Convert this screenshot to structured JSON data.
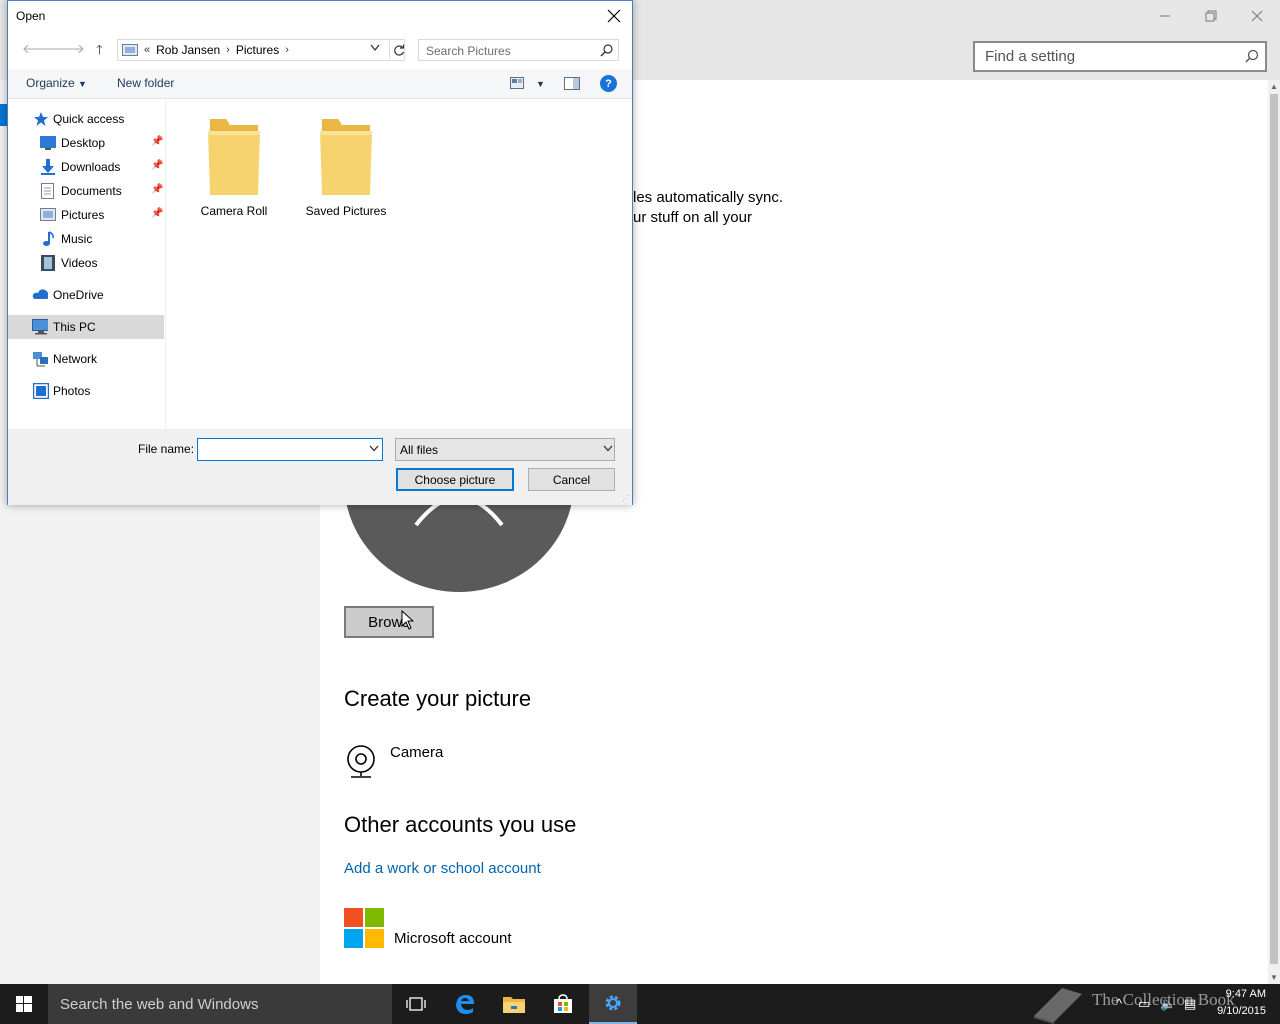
{
  "settings": {
    "search_placeholder": "Find a setting",
    "sync_line1": "les automatically sync.",
    "sync_line2": "ur stuff on all your",
    "browse_label": "Brows",
    "create_heading": "Create your picture",
    "camera_label": "Camera",
    "other_heading": "Other accounts you use",
    "add_work_link": "Add a work or school account",
    "ms_account_label": "Microsoft account",
    "colors": {
      "link": "#0063b1",
      "accent": "#0078d7"
    }
  },
  "dialog": {
    "title": "Open",
    "address": {
      "overflow": "«",
      "crumbs": [
        "Rob Jansen",
        "Pictures"
      ]
    },
    "search_placeholder": "Search Pictures",
    "organize_label": "Organize",
    "new_folder_label": "New folder",
    "help_label": "?",
    "nav": [
      {
        "label": "Quick access",
        "icon": "star-icon"
      },
      {
        "label": "Desktop",
        "icon": "desktop-icon",
        "pinned": true
      },
      {
        "label": "Downloads",
        "icon": "download-icon",
        "pinned": true
      },
      {
        "label": "Documents",
        "icon": "documents-icon",
        "pinned": true
      },
      {
        "label": "Pictures",
        "icon": "pictures-icon",
        "pinned": true
      },
      {
        "label": "Music",
        "icon": "music-icon"
      },
      {
        "label": "Videos",
        "icon": "videos-icon"
      },
      {
        "label": "OneDrive",
        "icon": "onedrive-icon"
      },
      {
        "label": "This PC",
        "icon": "computer-icon",
        "selected": true
      },
      {
        "label": "Network",
        "icon": "network-icon"
      },
      {
        "label": "Photos",
        "icon": "photos-icon"
      }
    ],
    "folders": [
      "Camera Roll",
      "Saved Pictures"
    ],
    "file_name_label": "File name:",
    "file_name_value": "",
    "filter_value": "All files",
    "choose_label": "Choose picture",
    "cancel_label": "Cancel"
  },
  "taskbar": {
    "search_placeholder": "Search the web and Windows",
    "time": "9:47 AM",
    "date": "9/10/2015",
    "watermark": "The Collection Book"
  }
}
